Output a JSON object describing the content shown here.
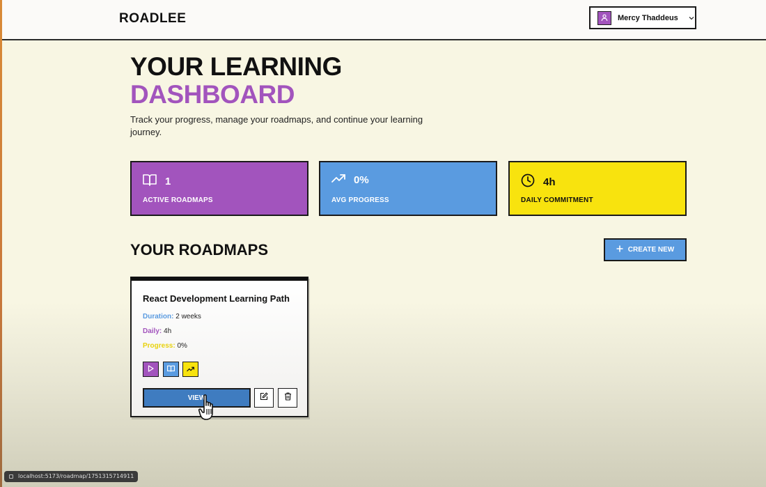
{
  "app": {
    "logo": "ROADLEE"
  },
  "user": {
    "name": "Mercy Thaddeus"
  },
  "header": {
    "title_line1": "YOUR LEARNING",
    "title_line2": "DASHBOARD",
    "subtitle": "Track your progress, manage your roadmaps, and continue your learning journey."
  },
  "stats": [
    {
      "value": "1",
      "label": "ACTIVE ROADMAPS",
      "icon": "book-open-icon",
      "color": "#a254bd"
    },
    {
      "value": "0%",
      "label": "AVG PROGRESS",
      "icon": "trending-up-icon",
      "color": "#5a9be0"
    },
    {
      "value": "4h",
      "label": "DAILY COMMITMENT",
      "icon": "clock-icon",
      "color": "#f8e30e"
    }
  ],
  "roadmaps_section": {
    "title": "YOUR ROADMAPS",
    "create_label": "CREATE NEW"
  },
  "roadmaps": [
    {
      "title": "React Development Learning Path",
      "duration_label": "Duration:",
      "duration": "2 weeks",
      "daily_label": "Daily:",
      "daily": "4h",
      "progress_label": "Progress:",
      "progress": "0%",
      "view_label": "VIEW"
    }
  ],
  "status_bar": {
    "url": "localhost:5173/roadmap/1751315714911"
  }
}
